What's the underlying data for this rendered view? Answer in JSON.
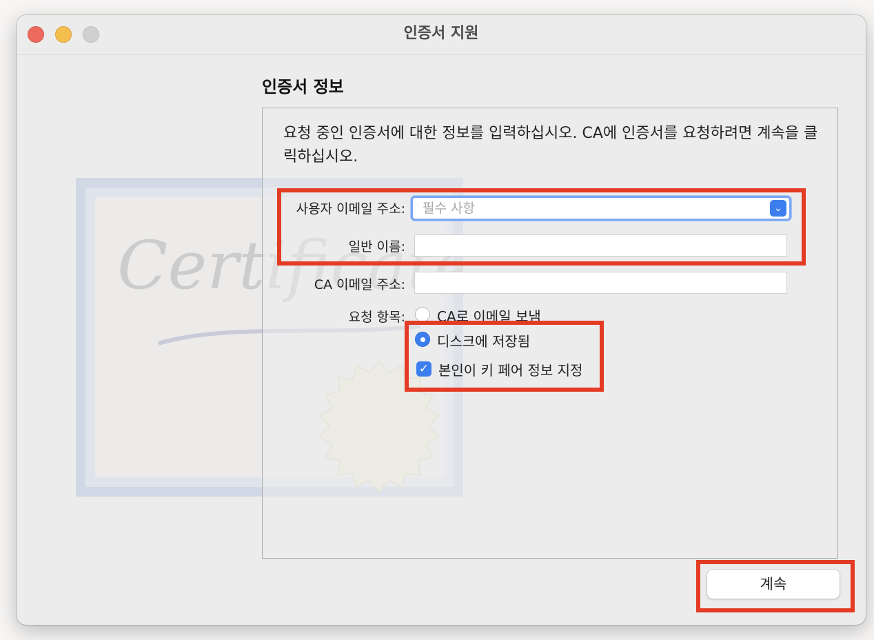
{
  "window": {
    "title": "인증서 지원"
  },
  "section": {
    "title": "인증서 정보",
    "intro": "요청 중인 인증서에 대한 정보를 입력하십시오. CA에 인증서를 요청하려면 계속을 클릭하십시오."
  },
  "form": {
    "user_email_label": "사용자 이메일 주소:",
    "user_email_placeholder": "필수 사항",
    "common_name_label": "일반 이름:",
    "common_name_value": "",
    "ca_email_label": "CA 이메일 주소:",
    "ca_email_value": "",
    "request_label": "요청 항목:",
    "options": {
      "email_to_ca": "CA로 이메일 보냄",
      "saved_to_disk": "디스크에 저장됨",
      "let_me_specify": "본인이 키 페어 정보 지정"
    },
    "selected_option": "saved_to_disk",
    "let_me_specify_checked": true
  },
  "buttons": {
    "continue": "계속"
  },
  "colors": {
    "accent": "#3d7eef",
    "highlight": "#e43b24"
  }
}
